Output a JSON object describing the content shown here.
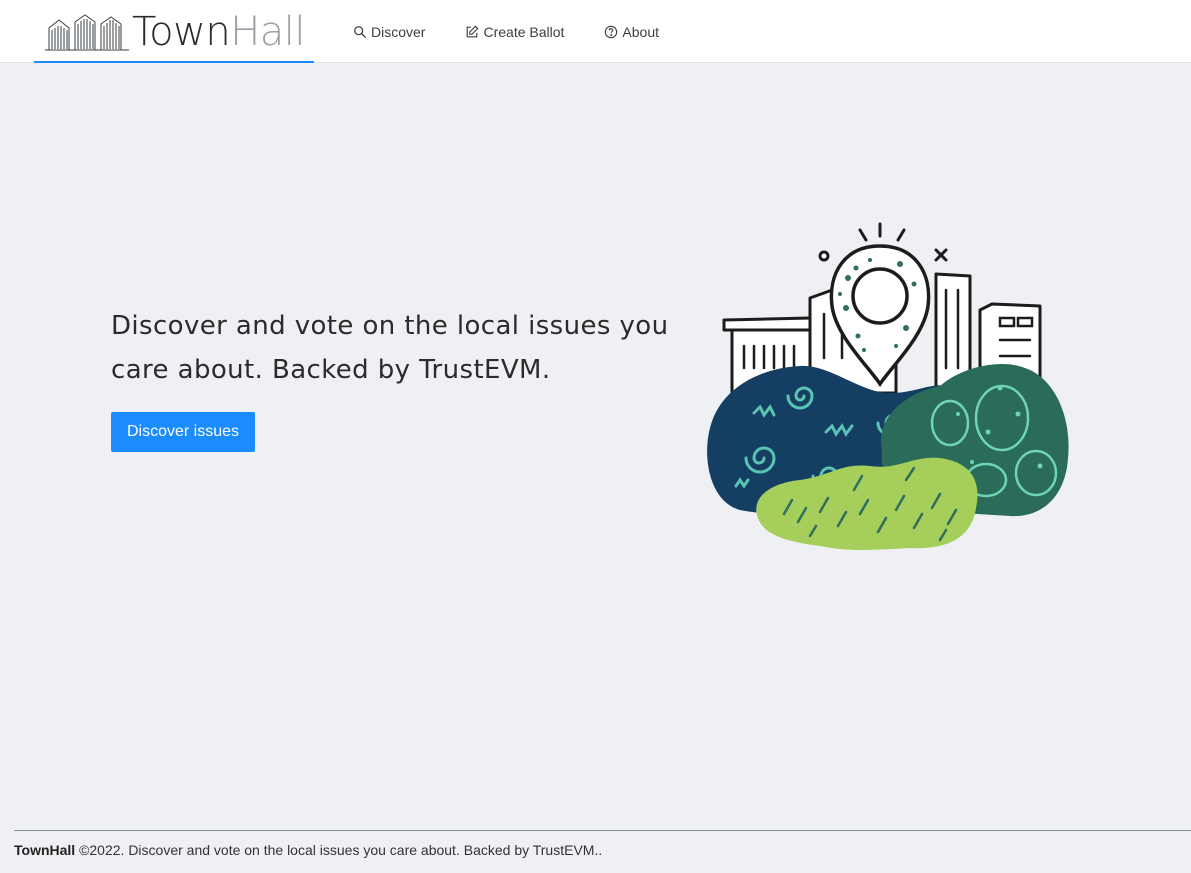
{
  "brand": {
    "name_part1": "Town",
    "name_part2": "Hall",
    "accent": "#1a8cff"
  },
  "nav": {
    "items": [
      {
        "label": "Discover",
        "icon": "search-icon"
      },
      {
        "label": "Create Ballot",
        "icon": "edit-icon"
      },
      {
        "label": "About",
        "icon": "help-circle-icon"
      }
    ]
  },
  "hero": {
    "headline": "Discover and vote on the local issues you care about. Backed by TrustEVM.",
    "cta_label": "Discover issues"
  },
  "footer": {
    "brand": "TownHall",
    "text": " ©2022. Discover and vote on the local issues you care about. Backed by TrustEVM.."
  }
}
